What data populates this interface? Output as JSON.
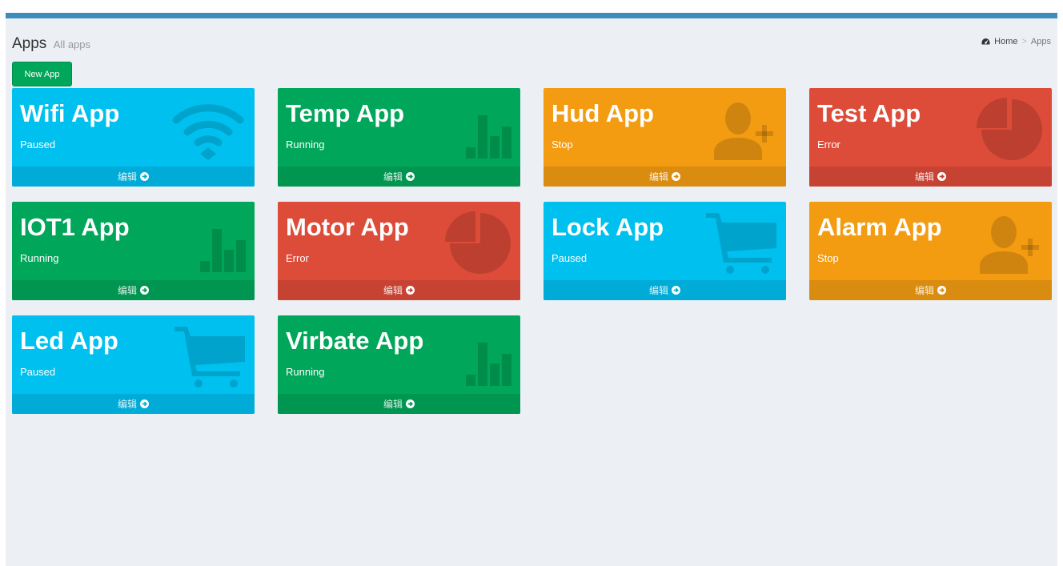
{
  "header": {
    "title": "Apps",
    "subtitle": "All apps"
  },
  "breadcrumb": {
    "home": "Home",
    "separator": ">",
    "current": "Apps",
    "home_icon": "dashboard-icon"
  },
  "actions": {
    "new_app": "New App"
  },
  "apps": [
    {
      "name": "Wifi App",
      "status": "Paused",
      "color": "#00c0ef",
      "icon": "wifi-icon",
      "edit": "编辑"
    },
    {
      "name": "Temp App",
      "status": "Running",
      "color": "#00a65a",
      "icon": "bar-chart-icon",
      "edit": "编辑"
    },
    {
      "name": "Hud App",
      "status": "Stop",
      "color": "#f39c12",
      "icon": "user-plus-icon",
      "edit": "编辑"
    },
    {
      "name": "Test App",
      "status": "Error",
      "color": "#dd4b39",
      "icon": "pie-chart-icon",
      "edit": "编辑"
    },
    {
      "name": "IOT1 App",
      "status": "Running",
      "color": "#00a65a",
      "icon": "bar-chart-icon",
      "edit": "编辑"
    },
    {
      "name": "Motor App",
      "status": "Error",
      "color": "#dd4b39",
      "icon": "pie-chart-icon",
      "edit": "编辑"
    },
    {
      "name": "Lock App",
      "status": "Paused",
      "color": "#00c0ef",
      "icon": "shopping-cart-icon",
      "edit": "编辑"
    },
    {
      "name": "Alarm App",
      "status": "Stop",
      "color": "#f39c12",
      "icon": "user-plus-icon",
      "edit": "编辑"
    },
    {
      "name": "Led App",
      "status": "Paused",
      "color": "#00c0ef",
      "icon": "shopping-cart-icon",
      "edit": "编辑"
    },
    {
      "name": "Virbate App",
      "status": "Running",
      "color": "#00a65a",
      "icon": "bar-chart-icon",
      "edit": "编辑"
    }
  ],
  "colors": {
    "topbar": "#3c8dbc",
    "background": "#ecf0f5"
  }
}
